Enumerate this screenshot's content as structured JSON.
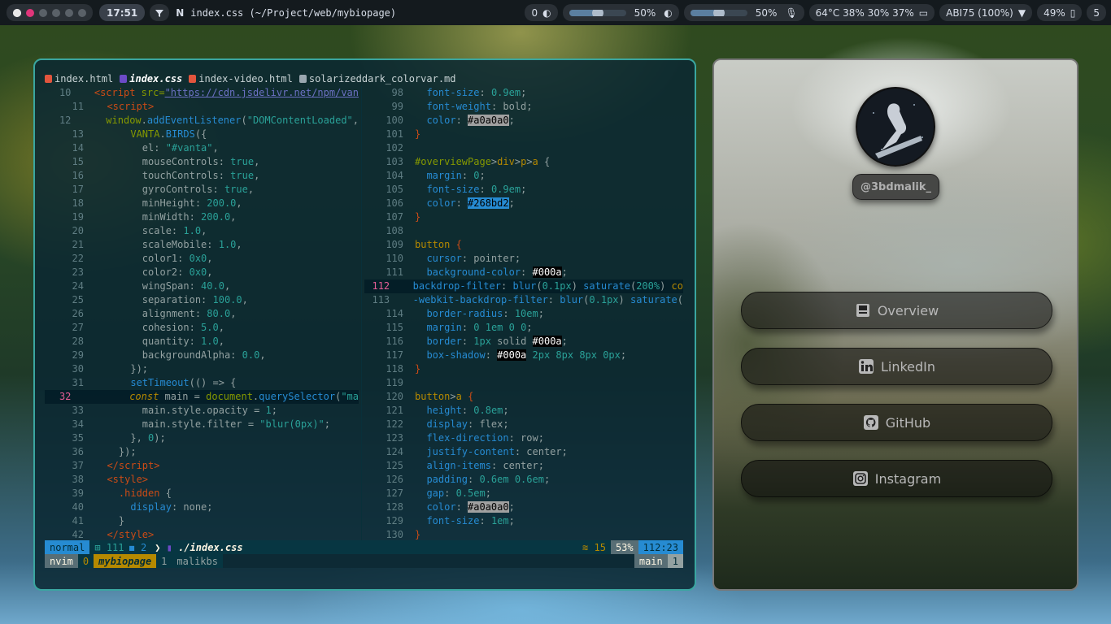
{
  "topbar": {
    "clock": "17:51",
    "window_title": "index.css (~/Project/web/mybiopage)",
    "notifications": "0",
    "volume_label": "50%",
    "volume_level": 0.5,
    "brightness_label": "50%",
    "brightness_level": 0.5,
    "stats": "64°C  38%  30%  37%",
    "network": "ABI75 (100%)",
    "battery": "49%",
    "workspace": "5"
  },
  "editor": {
    "tabs": [
      {
        "label": "index.html",
        "color": "#e2553d"
      },
      {
        "label": "index.css",
        "color": "#6c4bc7"
      },
      {
        "label": "index-video.html",
        "color": "#e2553d"
      },
      {
        "label": "solarizeddark_colorvar.md",
        "color": "#9aa7b0"
      }
    ],
    "left_lines": [
      {
        "n": "10",
        "html": "  <span class=\"t\">&lt;script</span> <span class=\"p\">src=</span><span class=\"u\">\"https://cdn.jsdelivr.net/npm/van</span>"
      },
      {
        "n": "11",
        "html": "  <span class=\"t\">&lt;script&gt;</span>"
      },
      {
        "n": "12",
        "html": "    <span class=\"p\">window</span>.<span class=\"f\">addEventListener</span>(<span class=\"s\">\"DOMContentLoaded\"</span>,"
      },
      {
        "n": "13",
        "html": "      <span class=\"p\">VANTA</span>.<span class=\"f\">BIRDS</span>({"
      },
      {
        "n": "14",
        "html": "        el: <span class=\"s\">\"#vanta\"</span>,"
      },
      {
        "n": "15",
        "html": "        mouseControls: <span class=\"s\">true</span>,"
      },
      {
        "n": "16",
        "html": "        touchControls: <span class=\"s\">true</span>,"
      },
      {
        "n": "17",
        "html": "        gyroControls: <span class=\"s\">true</span>,"
      },
      {
        "n": "18",
        "html": "        minHeight: <span class=\"s\">200.0</span>,"
      },
      {
        "n": "19",
        "html": "        minWidth: <span class=\"s\">200.0</span>,"
      },
      {
        "n": "20",
        "html": "        scale: <span class=\"s\">1.0</span>,"
      },
      {
        "n": "21",
        "html": "        scaleMobile: <span class=\"s\">1.0</span>,"
      },
      {
        "n": "22",
        "html": "        color1: <span class=\"s\">0x0</span>,"
      },
      {
        "n": "23",
        "html": "        color2: <span class=\"s\">0x0</span>,"
      },
      {
        "n": "24",
        "html": "        wingSpan: <span class=\"s\">40.0</span>,"
      },
      {
        "n": "25",
        "html": "        separation: <span class=\"s\">100.0</span>,"
      },
      {
        "n": "26",
        "html": "        alignment: <span class=\"s\">80.0</span>,"
      },
      {
        "n": "27",
        "html": "        cohesion: <span class=\"s\">5.0</span>,"
      },
      {
        "n": "28",
        "html": "        quantity: <span class=\"s\">1.0</span>,"
      },
      {
        "n": "29",
        "html": "        backgroundAlpha: <span class=\"s\">0.0</span>,"
      },
      {
        "n": "30",
        "html": "      });"
      },
      {
        "n": "31",
        "html": "      <span class=\"f\">setTimeout</span>(() =&gt; {"
      },
      {
        "n": "32",
        "html": "        <span class=\"k\"><i>const</i></span> main = <span class=\"p\">document</span>.<span class=\"f\">querySelector</span>(<span class=\"s\">\"ma</span>",
        "cur": true
      },
      {
        "n": "33",
        "html": "        main.style.opacity = <span class=\"s\">1</span>;"
      },
      {
        "n": "34",
        "html": "        main.style.filter = <span class=\"s\">\"blur(0px)\"</span>;"
      },
      {
        "n": "35",
        "html": "      }, <span class=\"s\">0</span>);"
      },
      {
        "n": "36",
        "html": "    });"
      },
      {
        "n": "37",
        "html": "  <span class=\"t\">&lt;/script&gt;</span>"
      },
      {
        "n": "38",
        "html": "  <span class=\"t\">&lt;style&gt;</span>"
      },
      {
        "n": "39",
        "html": "    <span class=\"t\">.hidden</span> {"
      },
      {
        "n": "40",
        "html": "      <span class=\"f\">display</span>: none;"
      },
      {
        "n": "41",
        "html": "    }"
      },
      {
        "n": "42",
        "html": "  <span class=\"t\">&lt;/style&gt;</span>"
      }
    ],
    "right_lines": [
      {
        "n": "98",
        "html": "  <span class=\"f\">font-size</span>: <span class=\"s\">0.9em</span>;"
      },
      {
        "n": "99",
        "html": "  <span class=\"f\">font-weight</span>: bold;"
      },
      {
        "n": "100",
        "html": "  <span class=\"f\">color</span>: <span class=\"hl0\">#a0a0a0</span>;"
      },
      {
        "n": "101",
        "html": "<span class=\"t\">}</span>"
      },
      {
        "n": "102",
        "html": ""
      },
      {
        "n": "103",
        "html": "<span class=\"p\">#overviewPage</span>&gt;<span class=\"k\">div</span>&gt;<span class=\"k\">p</span>&gt;<span class=\"k\">a</span> {"
      },
      {
        "n": "104",
        "html": "  <span class=\"f\">margin</span>: <span class=\"s\">0</span>;"
      },
      {
        "n": "105",
        "html": "  <span class=\"f\">font-size</span>: <span class=\"s\">0.9em</span>;"
      },
      {
        "n": "106",
        "html": "  <span class=\"f\">color</span>: <span class=\"hlb\">#268bd2</span>;"
      },
      {
        "n": "107",
        "html": "<span class=\"t\">}</span>"
      },
      {
        "n": "108",
        "html": ""
      },
      {
        "n": "109",
        "html": "<span class=\"k\">button</span> <span class=\"t\">{</span>"
      },
      {
        "n": "110",
        "html": "  <span class=\"f\">cursor</span>: pointer;"
      },
      {
        "n": "111",
        "html": "  <span class=\"f\">background-color</span>: <span class=\"hld\">#000a</span>;"
      },
      {
        "n": "112",
        "html": "  <span class=\"f\">backdrop-filter</span>: <span class=\"f\">blur</span>(<span class=\"s\">0.1px</span>) <span class=\"f\">saturate</span>(<span class=\"s\">200%</span>) <span class=\"k\">co</span>",
        "cur": true
      },
      {
        "n": "113",
        "html": "  <span class=\"f\">-webkit-backdrop-filter</span>: <span class=\"f\">blur</span>(<span class=\"s\">0.1px</span>) <span class=\"f\">saturate</span>("
      },
      {
        "n": "114",
        "html": "  <span class=\"f\">border-radius</span>: <span class=\"s\">10em</span>;"
      },
      {
        "n": "115",
        "html": "  <span class=\"f\">margin</span>: <span class=\"s\">0 1em 0 0</span>;"
      },
      {
        "n": "116",
        "html": "  <span class=\"f\">border</span>: <span class=\"s\">1px</span> solid <span class=\"hld\">#000a</span>;"
      },
      {
        "n": "117",
        "html": "  <span class=\"f\">box-shadow</span>: <span class=\"hld\">#000a</span> <span class=\"s\">2px 8px 8px 0px</span>;"
      },
      {
        "n": "118",
        "html": "<span class=\"t\">}</span>"
      },
      {
        "n": "119",
        "html": ""
      },
      {
        "n": "120",
        "html": "<span class=\"k\">button</span>&gt;<span class=\"k\">a</span> <span class=\"t\">{</span>"
      },
      {
        "n": "121",
        "html": "  <span class=\"f\">height</span>: <span class=\"s\">0.8em</span>;"
      },
      {
        "n": "122",
        "html": "  <span class=\"f\">display</span>: flex;"
      },
      {
        "n": "123",
        "html": "  <span class=\"f\">flex-direction</span>: row;"
      },
      {
        "n": "124",
        "html": "  <span class=\"f\">justify-content</span>: center;"
      },
      {
        "n": "125",
        "html": "  <span class=\"f\">align-items</span>: center;"
      },
      {
        "n": "126",
        "html": "  <span class=\"f\">padding</span>: <span class=\"s\">0.6em 0.6em</span>;"
      },
      {
        "n": "127",
        "html": "  <span class=\"f\">gap</span>: <span class=\"s\">0.5em</span>;"
      },
      {
        "n": "128",
        "html": "  <span class=\"f\">color</span>: <span class=\"hl0\">#a0a0a0</span>;"
      },
      {
        "n": "129",
        "html": "  <span class=\"f\">font-size</span>: <span class=\"s\">1em</span>;"
      },
      {
        "n": "130",
        "html": "<span class=\"t\">}</span>"
      }
    ],
    "status1": {
      "mode": "normal",
      "added": "111",
      "modified": "2",
      "file": "./index.css",
      "warnings": "15",
      "percent": "53%",
      "position": "112:23"
    },
    "status2": {
      "app": "nvim",
      "win_index": "0",
      "session": "mybiopage",
      "pane_index": "1",
      "pane_name": "malikbs",
      "branch": "main",
      "branch_index": "1"
    }
  },
  "profile": {
    "handle": "@3bdmalik_",
    "buttons": [
      {
        "label": "Overview",
        "icon": "overview-icon"
      },
      {
        "label": "LinkedIn",
        "icon": "linkedin-icon"
      },
      {
        "label": "GitHub",
        "icon": "github-icon"
      },
      {
        "label": "Instagram",
        "icon": "instagram-icon"
      }
    ]
  }
}
